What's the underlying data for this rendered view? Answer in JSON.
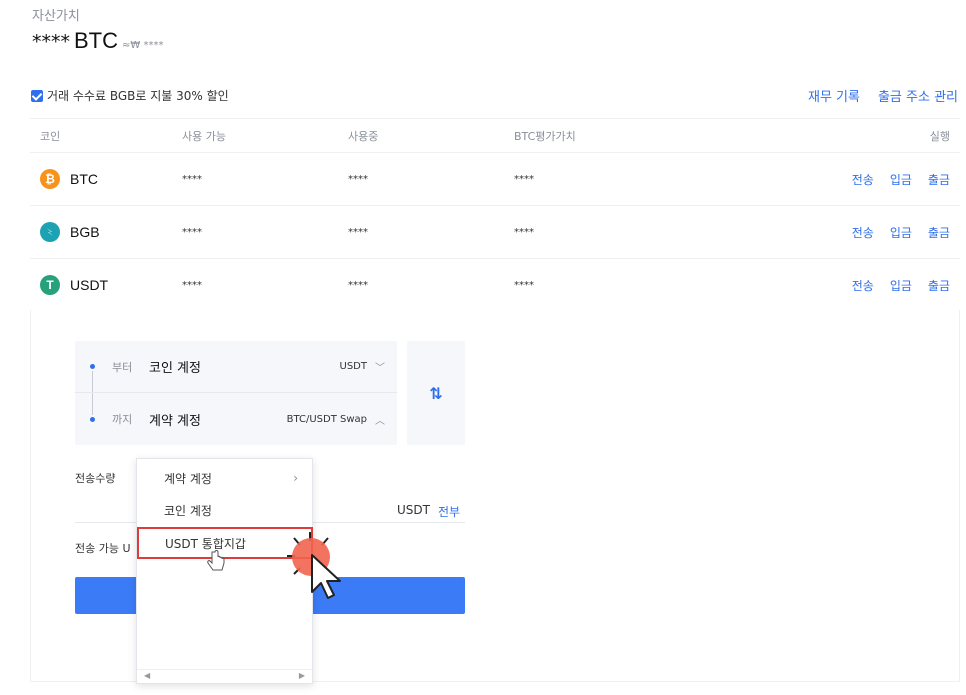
{
  "asset": {
    "label": "자산가치",
    "stars": "****",
    "currency": "BTC",
    "approx": "≈₩ ****"
  },
  "discount": {
    "label": "거래 수수료 BGB로 지불 30% 할인",
    "checked": true
  },
  "toplinks": {
    "records": "재무 기록",
    "address": "출금 주소 관리"
  },
  "table": {
    "headers": {
      "coin": "코인",
      "available": "사용 가능",
      "in_use": "사용중",
      "btc_value": "BTC평가가치",
      "action": "실행"
    },
    "rows": [
      {
        "coin": "BTC",
        "available": "****",
        "in_use": "****",
        "btc_value": "****",
        "icon": "bitcoin-icon",
        "color": "#f7931a"
      },
      {
        "coin": "BGB",
        "available": "****",
        "in_use": "****",
        "btc_value": "****",
        "icon": "bitget-icon",
        "color": "#1da2b4"
      },
      {
        "coin": "USDT",
        "available": "****",
        "in_use": "****",
        "btc_value": "****",
        "icon": "tether-icon",
        "color": "#26a17b"
      }
    ],
    "actions": {
      "transfer": "전송",
      "deposit": "입금",
      "withdraw": "출금"
    }
  },
  "transfer": {
    "from_label": "부터",
    "from_value": "코인 계정",
    "from_coin": "USDT",
    "to_label": "까지",
    "to_value": "계약 계정",
    "to_pair": "BTC/USDT Swap",
    "amount_label": "전송수량",
    "unit": "USDT",
    "all": "전부",
    "available_label": "전송 가능 U"
  },
  "dropdown": {
    "items": [
      {
        "label": "계약 계정",
        "has_submenu": true
      },
      {
        "label": "코인 계정",
        "has_submenu": false
      },
      {
        "label": "USDT 통합지갑",
        "has_submenu": false
      }
    ]
  },
  "colors": {
    "accent": "#2f6fed",
    "button": "#3b7bf6",
    "highlight": "#e03b3b",
    "click_marker": "#f26450"
  }
}
